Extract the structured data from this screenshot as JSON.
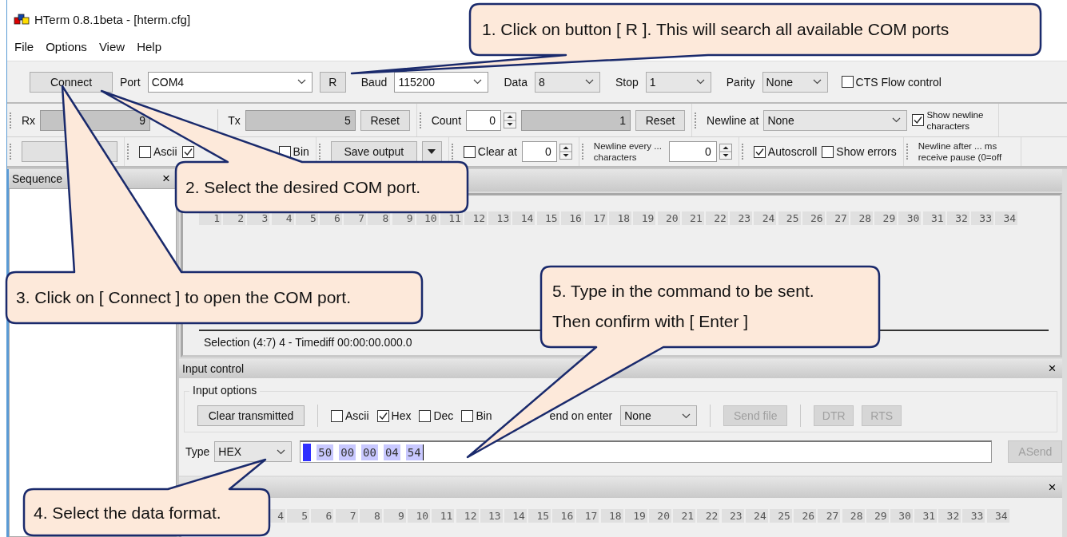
{
  "window": {
    "title": "HTerm 0.8.1beta - [hterm.cfg]"
  },
  "menu": [
    {
      "label": "File"
    },
    {
      "label": "Options"
    },
    {
      "label": "View"
    },
    {
      "label": "Help"
    }
  ],
  "connection_bar": [
    {
      "kind": "button",
      "label": "Connect"
    },
    {
      "kind": "label",
      "text": "Port"
    },
    {
      "kind": "dropdown",
      "value": "COM4",
      "editable": true
    },
    {
      "kind": "button",
      "label": "R"
    },
    {
      "kind": "label",
      "text": "Baud"
    },
    {
      "kind": "dropdown",
      "value": "115200",
      "editable": true
    },
    {
      "kind": "label",
      "text": "Data"
    },
    {
      "kind": "dropdown",
      "value": "8",
      "editable": false
    },
    {
      "kind": "label",
      "text": "Stop"
    },
    {
      "kind": "dropdown",
      "value": "1",
      "editable": false
    },
    {
      "kind": "label",
      "text": "Parity"
    },
    {
      "kind": "dropdown",
      "value": "None",
      "editable": false
    },
    {
      "kind": "checkbox",
      "label": "CTS Flow control",
      "checked": false
    }
  ],
  "counter_bar": [
    [
      {
        "kind": "label",
        "text": "Rx"
      },
      {
        "kind": "counter",
        "value": "9"
      },
      {
        "kind": "separator"
      },
      {
        "kind": "label",
        "text": "Tx"
      },
      {
        "kind": "counter",
        "value": "5"
      },
      {
        "kind": "button",
        "label": "Reset"
      }
    ],
    [
      {
        "kind": "label",
        "text": "Count"
      },
      {
        "kind": "spinner",
        "value": "0"
      },
      {
        "kind": "counter",
        "value": "1"
      },
      {
        "kind": "button",
        "label": "Reset"
      }
    ],
    [
      {
        "kind": "label",
        "text": "Newline at"
      },
      {
        "kind": "dropdown",
        "value": "None",
        "editable": false
      },
      {
        "kind": "checkbox",
        "label": "Show newline characters",
        "checked": true
      }
    ]
  ],
  "display_bar": [
    [
      {
        "kind": "button"
      }
    ],
    [
      {
        "kind": "checkbox",
        "label": "Ascii",
        "checked": false
      },
      {
        "kind": "checkbox",
        "checked": true
      },
      {
        "kind": "checkbox",
        "label": "Bin",
        "checked": false
      }
    ],
    [
      {
        "kind": "button",
        "label": "Save output"
      },
      {
        "kind": "arrow_button"
      }
    ],
    [
      {
        "kind": "checkbox",
        "label": "Clear at",
        "checked": false
      },
      {
        "kind": "spinner",
        "value": "0"
      }
    ],
    [
      {
        "kind": "note",
        "text": "Newline every ... characters"
      },
      {
        "kind": "spinner",
        "value": "0"
      }
    ],
    [
      {
        "kind": "checkbox",
        "label": "Autoscroll",
        "checked": true
      },
      {
        "kind": "checkbox",
        "label": "Show errors",
        "checked": false
      }
    ],
    [
      {
        "kind": "note",
        "text": "Newline after ... ms receive pause (0=off"
      }
    ]
  ],
  "sequence_panel": {
    "title": "Sequence",
    "close": "×"
  },
  "received_panel": {
    "ruler": [
      "1",
      "2",
      "3",
      "4",
      "5",
      "6",
      "7",
      "8",
      "9",
      "10",
      "11",
      "12",
      "13",
      "14",
      "15",
      "16",
      "17",
      "18",
      "19",
      "20",
      "21",
      "22",
      "23",
      "24",
      "25",
      "26",
      "27",
      "28",
      "29",
      "30",
      "31",
      "32",
      "33",
      "34"
    ],
    "status": "Selection (4:7) 4  -  Timediff 00:00:00.000.0"
  },
  "input_control": {
    "title": "Input control",
    "close": "×",
    "options_title": "Input options",
    "options": [
      {
        "kind": "button",
        "label": "Clear transmitted",
        "disabled": false
      },
      {
        "kind": "separator"
      },
      {
        "kind": "checkbox",
        "label": "Ascii",
        "checked": false
      },
      {
        "kind": "checkbox",
        "label": "Hex",
        "checked": true
      },
      {
        "kind": "checkbox",
        "label": "Dec",
        "checked": false
      },
      {
        "kind": "checkbox",
        "label": "Bin",
        "checked": false
      },
      {
        "kind": "label",
        "text": "end on enter"
      },
      {
        "kind": "dropdown",
        "value": "None",
        "editable": false
      },
      {
        "kind": "separator"
      },
      {
        "kind": "button",
        "label": "Send file",
        "disabled": true
      },
      {
        "kind": "separator"
      },
      {
        "kind": "button",
        "label": "DTR",
        "disabled": true
      },
      {
        "kind": "button",
        "label": "RTS",
        "disabled": true
      }
    ],
    "type_label": "Type",
    "type_value": "HEX",
    "bytes": [
      "50",
      "00",
      "00",
      "04",
      "54"
    ],
    "send_button": {
      "label": "ASend",
      "disabled": true
    }
  },
  "transmitted_panel": {
    "close": "×",
    "ruler": [
      "4",
      "5",
      "6",
      "7",
      "8",
      "9",
      "10",
      "11",
      "12",
      "13",
      "14",
      "15",
      "16",
      "17",
      "18",
      "19",
      "20",
      "21",
      "22",
      "23",
      "24",
      "25",
      "26",
      "27",
      "28",
      "29",
      "30",
      "31",
      "32",
      "33",
      "34"
    ]
  },
  "callouts": [
    {
      "text": "1. Click on button [ R ]. This will search all available COM ports"
    },
    {
      "text": "2. Select the desired COM port."
    },
    {
      "text": "3. Click on [ Connect ] to open the COM port."
    },
    {
      "text": "4. Select the data format."
    },
    {
      "text": "5. Type in the command to be sent. Then confirm with [ Enter ]"
    }
  ]
}
